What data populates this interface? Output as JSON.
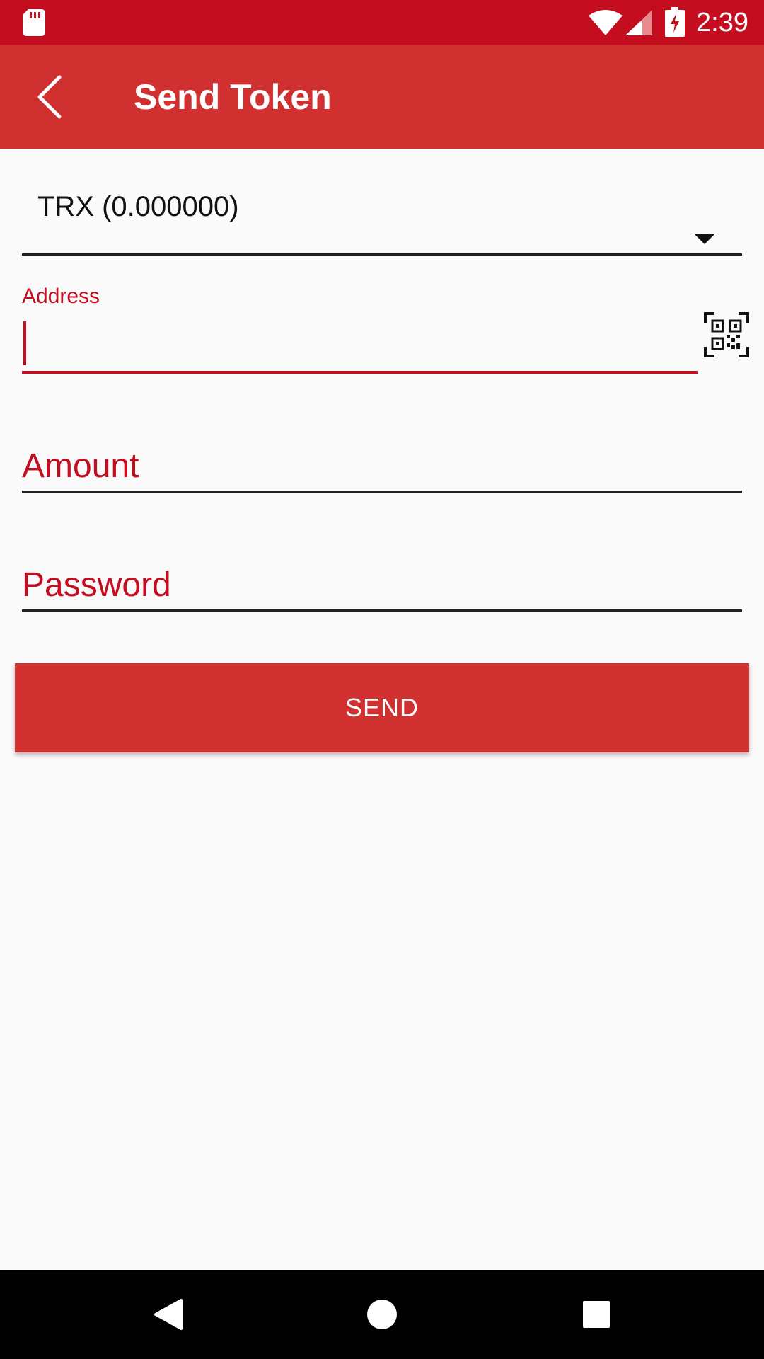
{
  "status_bar": {
    "time": "2:39",
    "icons": [
      "sd-card-icon",
      "wifi-icon",
      "signal-icon",
      "battery-charging-icon"
    ]
  },
  "app_bar": {
    "title": "Send Token",
    "back_icon": "back-arrow-icon"
  },
  "form": {
    "token_select": {
      "value": "TRX (0.000000)"
    },
    "address": {
      "label": "Address",
      "value": "",
      "qr_icon": "qr-scan-icon"
    },
    "amount": {
      "placeholder": "Amount",
      "value": ""
    },
    "password": {
      "placeholder": "Password",
      "value": ""
    },
    "send_label": "SEND"
  },
  "nav_bar": {
    "icons": [
      "nav-back-icon",
      "nav-home-icon",
      "nav-recent-icon"
    ]
  },
  "colors": {
    "status_bar": "#c40d1e",
    "app_bar": "#d03030",
    "accent": "#c40d1e",
    "background": "#fafafa"
  }
}
